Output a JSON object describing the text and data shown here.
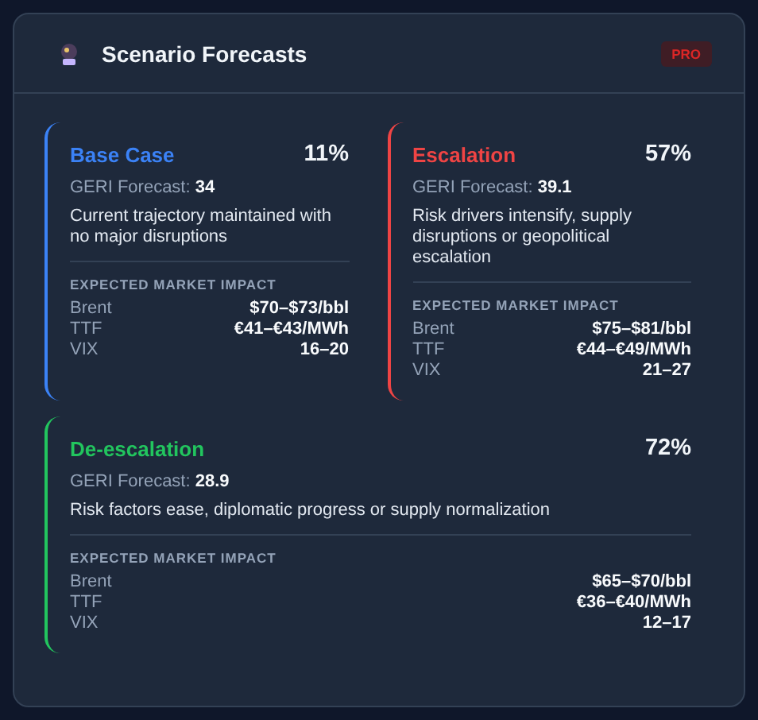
{
  "header": {
    "title": "Scenario Forecasts",
    "badge": "PRO"
  },
  "scenarios": [
    {
      "name": "Base Case",
      "color": "#3b82f6",
      "probability": "11%",
      "geri_label": "GERI Forecast:",
      "geri_value": "34",
      "description": "Current trajectory maintained with no major disruptions",
      "impact_heading": "EXPECTED MARKET IMPACT",
      "impacts": [
        {
          "label": "Brent",
          "value": "$70–$73/bbl"
        },
        {
          "label": "TTF",
          "value": "€41–€43/MWh"
        },
        {
          "label": "VIX",
          "value": "16–20"
        }
      ]
    },
    {
      "name": "Escalation",
      "color": "#ef4444",
      "probability": "57%",
      "geri_label": "GERI Forecast:",
      "geri_value": "39.1",
      "description": "Risk drivers intensify, supply disruptions or geopolitical escalation",
      "impact_heading": "EXPECTED MARKET IMPACT",
      "impacts": [
        {
          "label": "Brent",
          "value": "$75–$81/bbl"
        },
        {
          "label": "TTF",
          "value": "€44–€49/MWh"
        },
        {
          "label": "VIX",
          "value": "21–27"
        }
      ]
    },
    {
      "name": "De-escalation",
      "color": "#22c55e",
      "probability": "72%",
      "geri_label": "GERI Forecast:",
      "geri_value": "28.9",
      "description": "Risk factors ease, diplomatic progress or supply normalization",
      "impact_heading": "EXPECTED MARKET IMPACT",
      "impacts": [
        {
          "label": "Brent",
          "value": "$65–$70/bbl"
        },
        {
          "label": "TTF",
          "value": "€36–€40/MWh"
        },
        {
          "label": "VIX",
          "value": "12–17"
        }
      ]
    }
  ]
}
